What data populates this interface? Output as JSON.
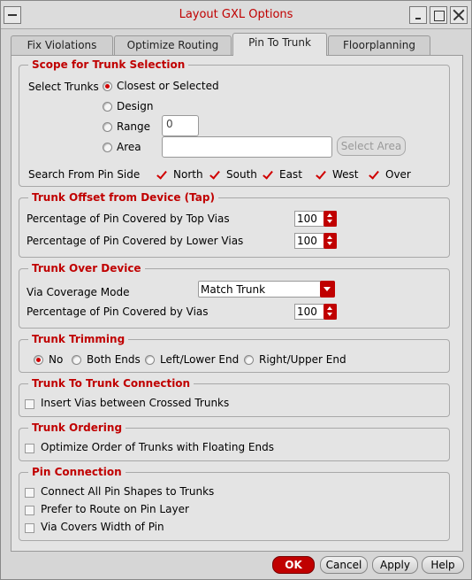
{
  "window": {
    "title": "Layout GXL Options"
  },
  "tabs": [
    {
      "label": "Fix Violations",
      "active": false
    },
    {
      "label": "Optimize Routing",
      "active": false
    },
    {
      "label": "Pin To Trunk",
      "active": true
    },
    {
      "label": "Floorplanning",
      "active": false
    }
  ],
  "scope": {
    "title": "Scope for Trunk Selection",
    "select_label": "Select Trunks",
    "options": [
      "Closest or Selected",
      "Design",
      "Range",
      "Area"
    ],
    "selected_index": 0,
    "range_value": "0",
    "area_value": "",
    "select_area_label": "Select Area",
    "search_side_label": "Search From Pin Side",
    "sides": [
      {
        "label": "North",
        "checked": true
      },
      {
        "label": "South",
        "checked": true
      },
      {
        "label": "East",
        "checked": true
      },
      {
        "label": "West",
        "checked": true
      },
      {
        "label": "Over",
        "checked": true
      }
    ]
  },
  "offset": {
    "title": "Trunk Offset from Device (Tap)",
    "top_label": "Percentage of Pin Covered by Top Vias",
    "top_value": "100",
    "lower_label": "Percentage of Pin Covered by Lower Vias",
    "lower_value": "100"
  },
  "over_device": {
    "title": "Trunk Over Device",
    "mode_label": "Via Coverage Mode",
    "mode_value": "Match Trunk",
    "pct_label": "Percentage of Pin Covered by Vias",
    "pct_value": "100"
  },
  "trimming": {
    "title": "Trunk Trimming",
    "options": [
      "No",
      "Both Ends",
      "Left/Lower End",
      "Right/Upper End"
    ],
    "selected_index": 0
  },
  "trunk_connection": {
    "title": "Trunk To Trunk Connection",
    "insert_label": "Insert Vias between Crossed Trunks",
    "insert_checked": false
  },
  "ordering": {
    "title": "Trunk Ordering",
    "optimize_label": "Optimize Order of Trunks with Floating Ends",
    "optimize_checked": false
  },
  "pin_connection": {
    "title": "Pin Connection",
    "items": [
      {
        "label": "Connect All Pin Shapes to Trunks",
        "checked": false
      },
      {
        "label": "Prefer to Route on Pin Layer",
        "checked": false
      },
      {
        "label": "Via Covers Width of Pin",
        "checked": false
      }
    ]
  },
  "buttons": {
    "ok": "OK",
    "cancel": "Cancel",
    "apply": "Apply",
    "help": "Help"
  },
  "colors": {
    "accent": "#c00000",
    "panel": "#e4e4e4",
    "background": "#d6d6d6"
  }
}
